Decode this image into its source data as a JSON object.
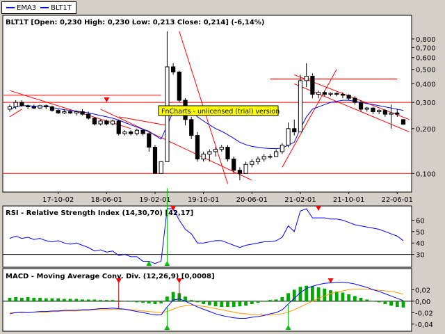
{
  "legend": {
    "items": [
      {
        "label": "EMA3",
        "color": "#0000ff"
      },
      {
        "label": "BLT1T",
        "color": "#0000ff"
      }
    ]
  },
  "price_panel": {
    "title": "BLT1T [Open: 0,230  High: 0,230  Low: 0,213  Close: 0,214] (-6,14%)",
    "watermark": "FnCharts - unlicensed (trial) version",
    "y_tick_labels": [
      "0,800",
      "0,700",
      "0,600",
      "0,500",
      "0,400",
      "0,300",
      "0,200",
      "0,100"
    ],
    "x_tick_labels": [
      "17-10-02",
      "18-06-01",
      "19-02-01",
      "19-10-01",
      "20-06-01",
      "21-02-01",
      "21-10-01",
      "22-06-01"
    ]
  },
  "rsi_panel": {
    "title": "RSI - Relative Strength Index (14,30,70) [42,17]",
    "y_tick_labels": [
      "60",
      "50",
      "40",
      "30"
    ]
  },
  "macd_panel": {
    "title": "MACD - Moving Average Conv. Div. (12,26,9) [0,0008]",
    "y_tick_labels": [
      "0,02",
      "0,00",
      "-0,02",
      "-0,04"
    ]
  },
  "colors": {
    "background": "#d4d0c8",
    "panel": "#ffffff",
    "trendline": "#ff0000",
    "ema": "#0000ff",
    "signal": "#ff9900",
    "histogram": "#00aa00",
    "watermark_bg": "#ffff00"
  },
  "chart_data": [
    {
      "type": "candlestick",
      "series_name": "BLT1T",
      "scale": "log",
      "ylim": [
        0.08,
        0.95
      ],
      "x_categories": [
        "17-10-02",
        "18-06-01",
        "19-02-01",
        "19-10-01",
        "20-06-01",
        "21-02-01",
        "21-10-01",
        "22-06-01"
      ],
      "ohlc": [
        {
          "o": 0.27,
          "h": 0.29,
          "l": 0.26,
          "c": 0.28
        },
        {
          "o": 0.28,
          "h": 0.31,
          "l": 0.27,
          "c": 0.3
        },
        {
          "o": 0.3,
          "h": 0.31,
          "l": 0.28,
          "c": 0.285
        },
        {
          "o": 0.285,
          "h": 0.29,
          "l": 0.27,
          "c": 0.28
        },
        {
          "o": 0.28,
          "h": 0.29,
          "l": 0.27,
          "c": 0.275
        },
        {
          "o": 0.275,
          "h": 0.29,
          "l": 0.27,
          "c": 0.285
        },
        {
          "o": 0.285,
          "h": 0.29,
          "l": 0.27,
          "c": 0.28
        },
        {
          "o": 0.28,
          "h": 0.285,
          "l": 0.26,
          "c": 0.265
        },
        {
          "o": 0.265,
          "h": 0.27,
          "l": 0.25,
          "c": 0.255
        },
        {
          "o": 0.255,
          "h": 0.27,
          "l": 0.25,
          "c": 0.26
        },
        {
          "o": 0.26,
          "h": 0.265,
          "l": 0.25,
          "c": 0.255
        },
        {
          "o": 0.255,
          "h": 0.265,
          "l": 0.245,
          "c": 0.26
        },
        {
          "o": 0.26,
          "h": 0.27,
          "l": 0.245,
          "c": 0.25
        },
        {
          "o": 0.25,
          "h": 0.26,
          "l": 0.23,
          "c": 0.235
        },
        {
          "o": 0.235,
          "h": 0.24,
          "l": 0.21,
          "c": 0.215
        },
        {
          "o": 0.215,
          "h": 0.23,
          "l": 0.21,
          "c": 0.225
        },
        {
          "o": 0.225,
          "h": 0.23,
          "l": 0.21,
          "c": 0.215
        },
        {
          "o": 0.215,
          "h": 0.23,
          "l": 0.21,
          "c": 0.225
        },
        {
          "o": 0.225,
          "h": 0.23,
          "l": 0.18,
          "c": 0.185
        },
        {
          "o": 0.185,
          "h": 0.195,
          "l": 0.18,
          "c": 0.19
        },
        {
          "o": 0.19,
          "h": 0.195,
          "l": 0.18,
          "c": 0.185
        },
        {
          "o": 0.185,
          "h": 0.2,
          "l": 0.18,
          "c": 0.195
        },
        {
          "o": 0.195,
          "h": 0.2,
          "l": 0.18,
          "c": 0.185
        },
        {
          "o": 0.185,
          "h": 0.19,
          "l": 0.14,
          "c": 0.15
        },
        {
          "o": 0.15,
          "h": 0.155,
          "l": 0.1,
          "c": 0.1
        },
        {
          "o": 0.1,
          "h": 0.12,
          "l": 0.1,
          "c": 0.12
        },
        {
          "o": 0.12,
          "h": 0.9,
          "l": 0.12,
          "c": 0.52
        },
        {
          "o": 0.52,
          "h": 0.55,
          "l": 0.46,
          "c": 0.48
        },
        {
          "o": 0.48,
          "h": 0.49,
          "l": 0.3,
          "c": 0.31
        },
        {
          "o": 0.31,
          "h": 0.32,
          "l": 0.21,
          "c": 0.23
        },
        {
          "o": 0.23,
          "h": 0.24,
          "l": 0.17,
          "c": 0.18
        },
        {
          "o": 0.18,
          "h": 0.19,
          "l": 0.12,
          "c": 0.125
        },
        {
          "o": 0.125,
          "h": 0.14,
          "l": 0.12,
          "c": 0.135
        },
        {
          "o": 0.135,
          "h": 0.145,
          "l": 0.12,
          "c": 0.14
        },
        {
          "o": 0.14,
          "h": 0.15,
          "l": 0.13,
          "c": 0.145
        },
        {
          "o": 0.145,
          "h": 0.155,
          "l": 0.14,
          "c": 0.15
        },
        {
          "o": 0.15,
          "h": 0.155,
          "l": 0.12,
          "c": 0.125
        },
        {
          "o": 0.125,
          "h": 0.13,
          "l": 0.1,
          "c": 0.105
        },
        {
          "o": 0.105,
          "h": 0.11,
          "l": 0.09,
          "c": 0.1
        },
        {
          "o": 0.1,
          "h": 0.12,
          "l": 0.1,
          "c": 0.115
        },
        {
          "o": 0.115,
          "h": 0.125,
          "l": 0.11,
          "c": 0.12
        },
        {
          "o": 0.12,
          "h": 0.13,
          "l": 0.115,
          "c": 0.125
        },
        {
          "o": 0.125,
          "h": 0.135,
          "l": 0.12,
          "c": 0.13
        },
        {
          "o": 0.13,
          "h": 0.135,
          "l": 0.125,
          "c": 0.13
        },
        {
          "o": 0.13,
          "h": 0.145,
          "l": 0.13,
          "c": 0.14
        },
        {
          "o": 0.14,
          "h": 0.16,
          "l": 0.135,
          "c": 0.155
        },
        {
          "o": 0.155,
          "h": 0.22,
          "l": 0.15,
          "c": 0.2
        },
        {
          "o": 0.2,
          "h": 0.23,
          "l": 0.18,
          "c": 0.19
        },
        {
          "o": 0.19,
          "h": 0.46,
          "l": 0.19,
          "c": 0.42
        },
        {
          "o": 0.42,
          "h": 0.55,
          "l": 0.38,
          "c": 0.45
        },
        {
          "o": 0.45,
          "h": 0.47,
          "l": 0.32,
          "c": 0.34
        },
        {
          "o": 0.34,
          "h": 0.36,
          "l": 0.32,
          "c": 0.35
        },
        {
          "o": 0.35,
          "h": 0.36,
          "l": 0.33,
          "c": 0.34
        },
        {
          "o": 0.34,
          "h": 0.35,
          "l": 0.33,
          "c": 0.345
        },
        {
          "o": 0.345,
          "h": 0.35,
          "l": 0.33,
          "c": 0.34
        },
        {
          "o": 0.34,
          "h": 0.35,
          "l": 0.32,
          "c": 0.335
        },
        {
          "o": 0.335,
          "h": 0.34,
          "l": 0.31,
          "c": 0.32
        },
        {
          "o": 0.32,
          "h": 0.33,
          "l": 0.29,
          "c": 0.3
        },
        {
          "o": 0.3,
          "h": 0.31,
          "l": 0.26,
          "c": 0.27
        },
        {
          "o": 0.27,
          "h": 0.28,
          "l": 0.26,
          "c": 0.275
        },
        {
          "o": 0.275,
          "h": 0.28,
          "l": 0.25,
          "c": 0.26
        },
        {
          "o": 0.26,
          "h": 0.27,
          "l": 0.25,
          "c": 0.265
        },
        {
          "o": 0.265,
          "h": 0.27,
          "l": 0.24,
          "c": 0.25
        },
        {
          "o": 0.25,
          "h": 0.29,
          "l": 0.2,
          "c": 0.255
        },
        {
          "o": 0.255,
          "h": 0.27,
          "l": 0.24,
          "c": 0.25
        },
        {
          "o": 0.23,
          "h": 0.23,
          "l": 0.213,
          "c": 0.214
        }
      ],
      "ema": [
        0.27,
        0.28,
        0.285,
        0.285,
        0.283,
        0.283,
        0.282,
        0.278,
        0.272,
        0.268,
        0.265,
        0.262,
        0.259,
        0.255,
        0.25,
        0.245,
        0.24,
        0.235,
        0.228,
        0.22,
        0.212,
        0.205,
        0.198,
        0.192,
        0.18,
        0.17,
        0.21,
        0.26,
        0.28,
        0.275,
        0.26,
        0.24,
        0.225,
        0.212,
        0.2,
        0.192,
        0.182,
        0.172,
        0.162,
        0.156,
        0.152,
        0.15,
        0.148,
        0.147,
        0.147,
        0.148,
        0.155,
        0.162,
        0.2,
        0.24,
        0.27,
        0.28,
        0.29,
        0.3,
        0.305,
        0.31,
        0.31,
        0.305,
        0.3,
        0.295,
        0.29,
        0.285,
        0.28,
        0.275,
        0.27,
        0.265
      ],
      "horizontal_levels": [
        0.3,
        0.1,
        0.43
      ],
      "signal_arrows": [
        {
          "index": 16,
          "direction": "down"
        }
      ],
      "trendlines": [
        {
          "from": [
            0,
            0.36
          ],
          "to": [
            20,
            0.2
          ]
        },
        {
          "from": [
            0,
            0.24
          ],
          "to": [
            2,
            0.27
          ]
        },
        {
          "from": [
            18,
            0.24
          ],
          "to": [
            26,
            0.21
          ]
        },
        {
          "from": [
            15,
            0.27
          ],
          "to": [
            40,
            0.09
          ]
        },
        {
          "from": [
            28,
            0.9
          ],
          "to": [
            36,
            0.085
          ]
        },
        {
          "from": [
            45,
            0.11
          ],
          "to": [
            54,
            0.5
          ]
        },
        {
          "from": [
            47,
            0.46
          ],
          "to": [
            66,
            0.23
          ]
        },
        {
          "from": [
            47,
            0.4
          ],
          "to": [
            66,
            0.19
          ]
        },
        {
          "from": [
            -1,
            0.335
          ],
          "to": [
            25,
            0.335
          ]
        },
        {
          "from": [
            43,
            0.43
          ],
          "to": [
            64,
            0.43
          ]
        }
      ]
    },
    {
      "type": "line",
      "series_name": "RSI",
      "ylim": [
        20,
        70
      ],
      "levels": [
        30,
        70
      ],
      "values": [
        44,
        46,
        44,
        45,
        43,
        44,
        42,
        41,
        42,
        40,
        39,
        40,
        38,
        36,
        33,
        34,
        32,
        33,
        29,
        30,
        28,
        28,
        24,
        24,
        22,
        24,
        88,
        72,
        60,
        52,
        48,
        40,
        40,
        41,
        42,
        42,
        40,
        38,
        36,
        38,
        39,
        40,
        41,
        41,
        42,
        45,
        55,
        50,
        68,
        70,
        62,
        62,
        62,
        61,
        61,
        60,
        58,
        56,
        55,
        54,
        53,
        52,
        50,
        48,
        46,
        42
      ],
      "buy_markers": [
        23,
        26
      ],
      "sell_markers": [
        27,
        51
      ]
    },
    {
      "type": "line",
      "series_name": "MACD",
      "ylim": [
        -0.05,
        0.035
      ],
      "macd": [
        -0.022,
        -0.02,
        -0.019,
        -0.02,
        -0.019,
        -0.018,
        -0.018,
        -0.017,
        -0.017,
        -0.016,
        -0.016,
        -0.016,
        -0.015,
        -0.015,
        -0.014,
        -0.013,
        -0.013,
        -0.012,
        -0.013,
        -0.014,
        -0.016,
        -0.018,
        -0.02,
        -0.022,
        -0.024,
        -0.024,
        -0.01,
        0.002,
        0.004,
        0.0,
        -0.005,
        -0.01,
        -0.014,
        -0.018,
        -0.022,
        -0.025,
        -0.027,
        -0.029,
        -0.03,
        -0.03,
        -0.028,
        -0.027,
        -0.025,
        -0.022,
        -0.02,
        -0.015,
        -0.005,
        0.005,
        0.015,
        0.022,
        0.026,
        0.029,
        0.031,
        0.032,
        0.033,
        0.033,
        0.032,
        0.03,
        0.027,
        0.024,
        0.02,
        0.017,
        0.013,
        0.009,
        0.005,
        0.001
      ],
      "signal": [
        -0.02,
        -0.02,
        -0.02,
        -0.02,
        -0.019,
        -0.019,
        -0.019,
        -0.018,
        -0.018,
        -0.017,
        -0.017,
        -0.017,
        -0.016,
        -0.016,
        -0.015,
        -0.015,
        -0.015,
        -0.014,
        -0.014,
        -0.014,
        -0.015,
        -0.016,
        -0.017,
        -0.018,
        -0.019,
        -0.02,
        -0.018,
        -0.014,
        -0.01,
        -0.008,
        -0.007,
        -0.008,
        -0.009,
        -0.011,
        -0.013,
        -0.015,
        -0.017,
        -0.019,
        -0.021,
        -0.022,
        -0.023,
        -0.024,
        -0.024,
        -0.024,
        -0.023,
        -0.022,
        -0.019,
        -0.015,
        -0.01,
        -0.005,
        0.0,
        0.005,
        0.009,
        0.013,
        0.016,
        0.018,
        0.02,
        0.021,
        0.021,
        0.021,
        0.02,
        0.019,
        0.018,
        0.017,
        0.015,
        0.012
      ],
      "histogram": [
        0.006,
        0.007,
        0.006,
        0.007,
        0.006,
        0.006,
        0.005,
        0.005,
        0.005,
        0.004,
        0.004,
        0.004,
        0.003,
        0.003,
        0.003,
        0.002,
        0.002,
        0.002,
        0.001,
        0.0,
        -0.001,
        -0.002,
        -0.003,
        -0.004,
        -0.005,
        -0.004,
        0.008,
        0.016,
        0.014,
        0.008,
        0.002,
        -0.002,
        -0.005,
        -0.007,
        -0.009,
        -0.01,
        -0.01,
        -0.01,
        -0.009,
        -0.008,
        -0.005,
        -0.003,
        -0.001,
        0.002,
        0.003,
        0.007,
        0.014,
        0.02,
        0.025,
        0.027,
        0.026,
        0.024,
        0.022,
        0.019,
        0.017,
        0.015,
        0.012,
        0.009,
        0.006,
        0.003,
        0.0,
        -0.002,
        -0.005,
        -0.008,
        -0.01,
        -0.011
      ],
      "buy_markers": [
        26,
        46
      ],
      "sell_markers": [
        18,
        28,
        53
      ]
    }
  ]
}
